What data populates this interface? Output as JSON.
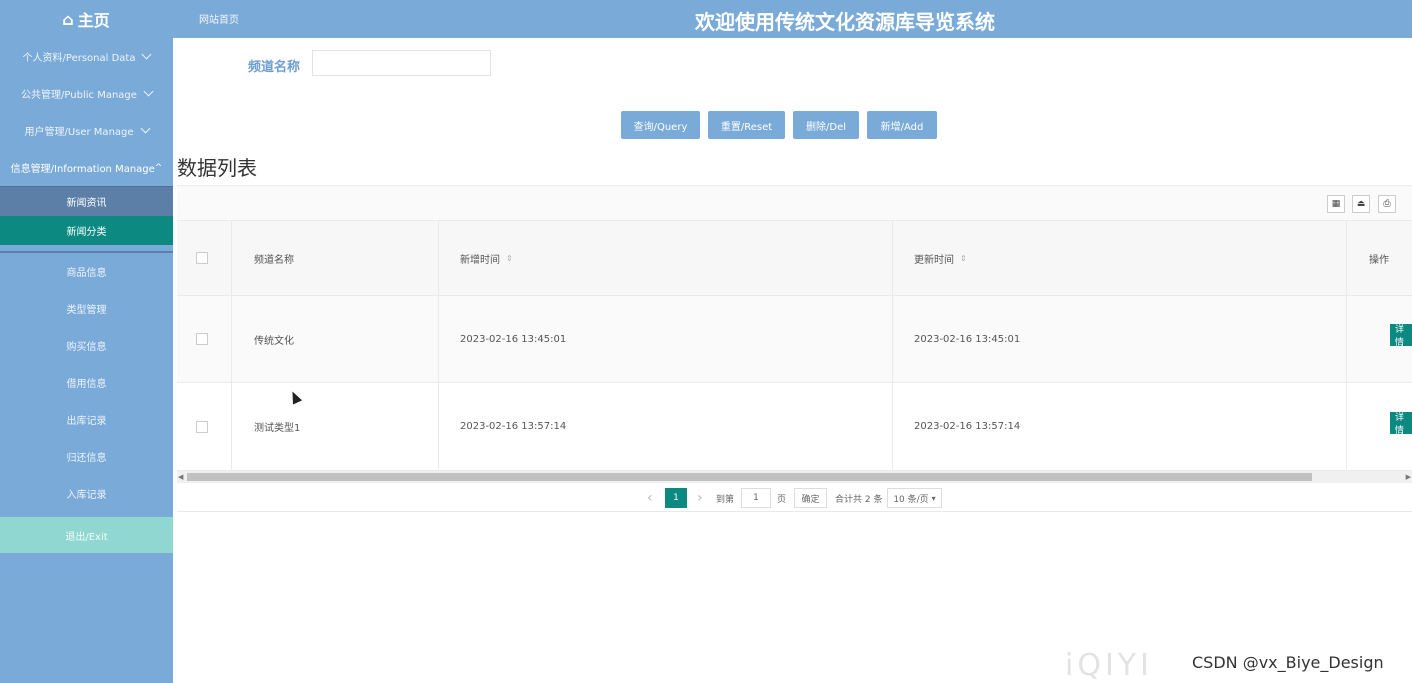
{
  "header": {
    "home_label": "主页",
    "site_link": "网站首页",
    "system_title": "欢迎使用传统文化资源库导览系统"
  },
  "sidebar": {
    "menus": [
      {
        "label": "个人资料/Personal Data"
      },
      {
        "label": "公共管理/Public Manage"
      },
      {
        "label": "用户管理/User Manage"
      },
      {
        "label": "信息管理/Information Manage"
      }
    ],
    "submenu": [
      {
        "label": "新闻资讯"
      },
      {
        "label": "新闻分类"
      },
      {
        "label": "商品信息"
      },
      {
        "label": "类型管理"
      },
      {
        "label": "购买信息"
      },
      {
        "label": "借用信息"
      },
      {
        "label": "出库记录"
      },
      {
        "label": "归还信息"
      },
      {
        "label": "入库记录"
      }
    ],
    "exit_label": "退出/Exit"
  },
  "search": {
    "label": "频道名称",
    "value": "",
    "placeholder": ""
  },
  "buttons": {
    "query": "查询/Query",
    "reset": "重置/Reset",
    "delete": "删除/Del",
    "add": "新增/Add"
  },
  "list_title": "数据列表",
  "table": {
    "columns": [
      "频道名称",
      "新增时间",
      "更新时间",
      "操作"
    ],
    "rows": [
      {
        "name": "传统文化",
        "created": "2023-02-16 13:45:01",
        "updated": "2023-02-16 13:45:01",
        "action": "详情"
      },
      {
        "name": "测试类型1",
        "created": "2023-02-16 13:57:14",
        "updated": "2023-02-16 13:57:14",
        "action": "详情"
      }
    ]
  },
  "pagination": {
    "current_page": "1",
    "goto_label": "到第",
    "goto_value": "1",
    "page_unit": "页",
    "confirm": "确定",
    "total": "合计共 2 条",
    "page_size": "10 条/页"
  },
  "watermark": "iQIYI",
  "credit": "CSDN @vx_Biye_Design",
  "colors": {
    "header_bg": "#7aaad8",
    "sidebar_bg": "#7aaad8",
    "active_teal": "#0c8a82",
    "exit_bg": "#8fd7d0",
    "label_blue": "#6e9fcf"
  }
}
